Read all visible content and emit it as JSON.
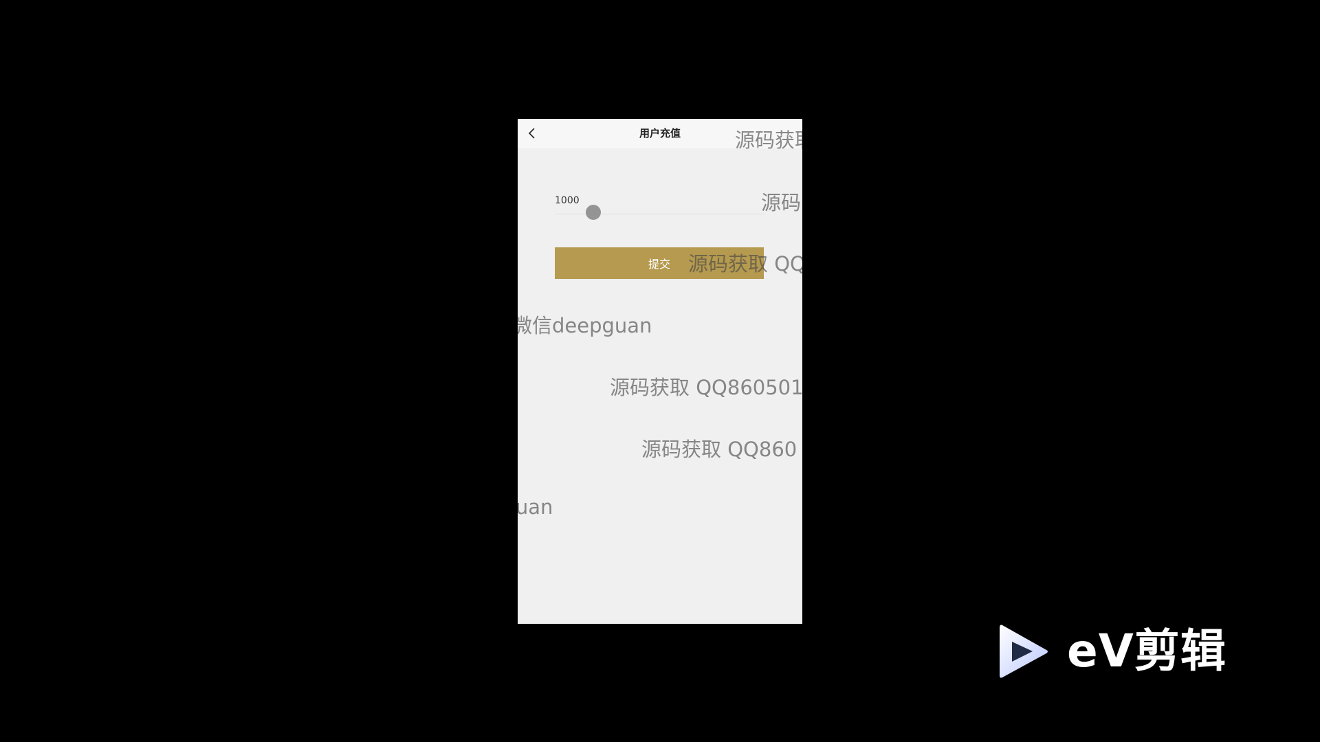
{
  "header": {
    "back_icon": "chevron-left-icon",
    "title": "用户充值"
  },
  "form": {
    "amount_value": "1000",
    "submit_label": "提交"
  },
  "watermarks": [
    "源码获取",
    "源码",
    "源码获取 QQ",
    "微信deepguan",
    "源码获取 QQ860501",
    "源码获取 QQ860",
    "pguan"
  ],
  "overlay_logo": {
    "icon": "play-triangle-logo-icon",
    "text": "eV剪辑"
  },
  "colors": {
    "background": "#000000",
    "screen_background": "#f0f0f0",
    "accent_button": "#b59a4f",
    "button_text": "#ffffff"
  }
}
